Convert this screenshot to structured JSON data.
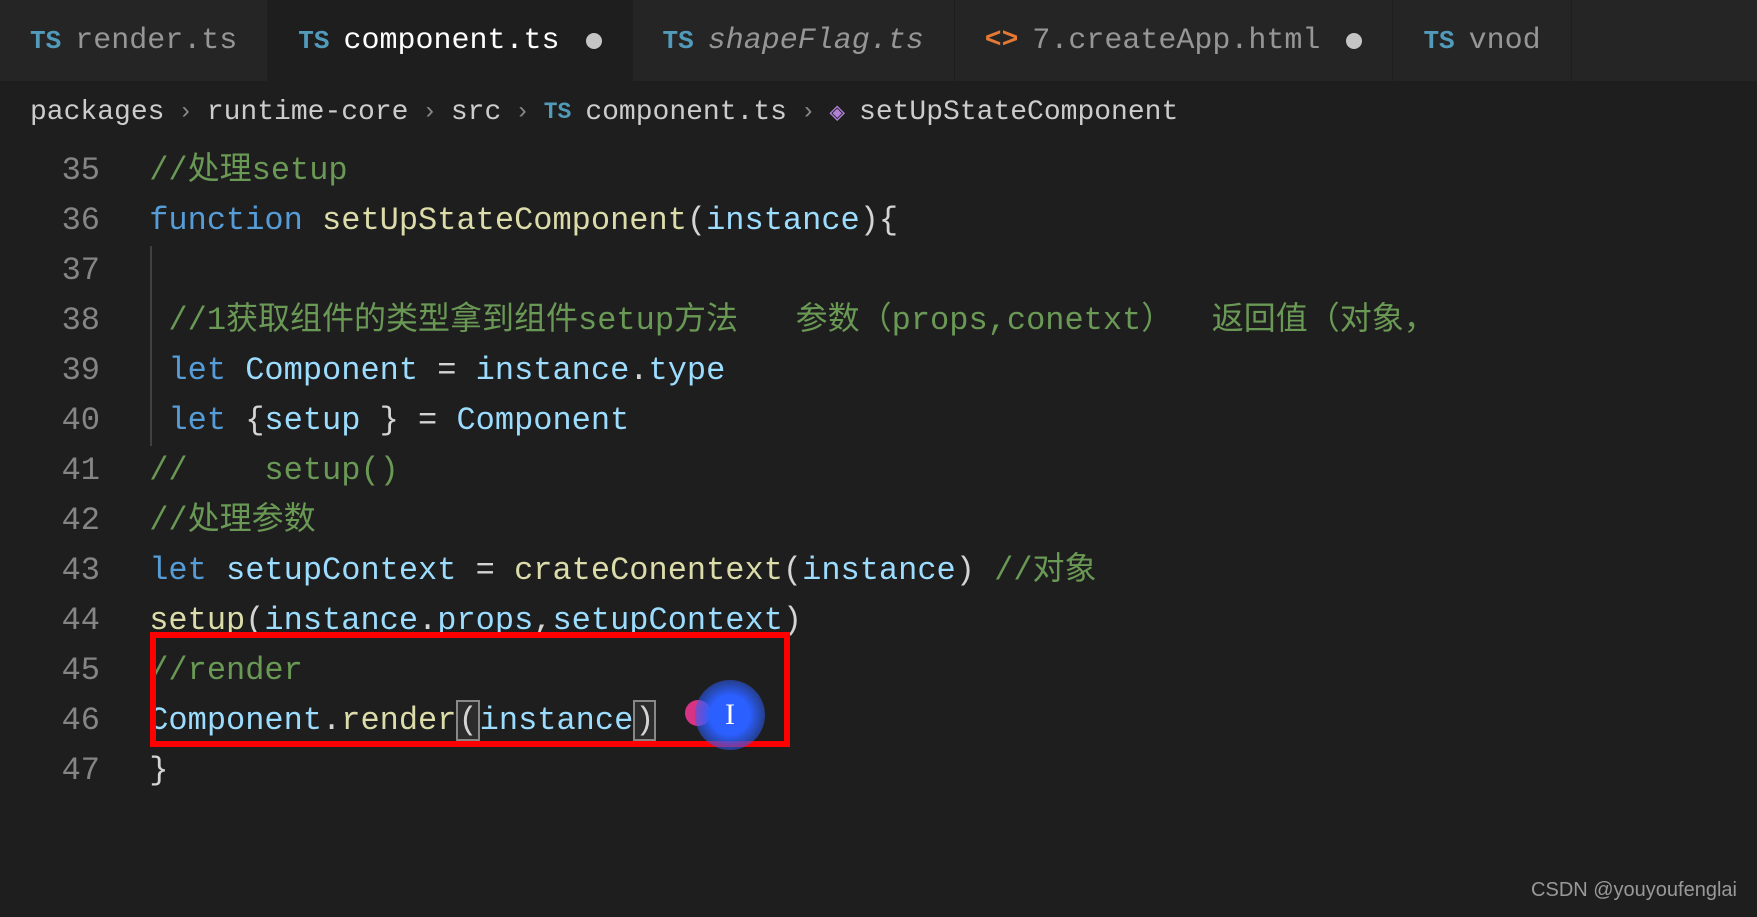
{
  "tabs": [
    {
      "icon": "TS",
      "label": "render.ts",
      "dirty": false,
      "active": false
    },
    {
      "icon": "TS",
      "label": "component.ts",
      "dirty": true,
      "active": true
    },
    {
      "icon": "TS",
      "label": "shapeFlag.ts",
      "dirty": false,
      "active": false
    },
    {
      "icon": "<>",
      "label": "7.createApp.html",
      "dirty": true,
      "active": false
    },
    {
      "icon": "TS",
      "label": "vnod",
      "dirty": false,
      "active": false
    }
  ],
  "breadcrumbs": {
    "parts": [
      "packages",
      "runtime-core",
      "src"
    ],
    "file_icon": "TS",
    "file": "component.ts",
    "symbol_icon": "◈",
    "symbol": "setUpStateComponent"
  },
  "lines": {
    "l35": {
      "num": "35",
      "comment": "//处理setup"
    },
    "l36": {
      "num": "36",
      "kw": "function",
      "fn": "setUpStateComponent",
      "param": "instance"
    },
    "l37": {
      "num": "37"
    },
    "l38": {
      "num": "38",
      "comment": "//1获取组件的类型拿到组件setup方法   参数（props,conetxt）  返回值（对象，"
    },
    "l39": {
      "num": "39",
      "kw": "let",
      "var1": "Component",
      "var2": "instance",
      "prop": "type"
    },
    "l40": {
      "num": "40",
      "kw": "let",
      "var1": "setup",
      "var2": "Component"
    },
    "l41": {
      "num": "41",
      "comment": "//    setup()"
    },
    "l42": {
      "num": "42",
      "comment": "//处理参数"
    },
    "l43": {
      "num": "43",
      "kw": "let",
      "var1": "setupContext",
      "fn": "crateConentext",
      "arg": "instance",
      "comment": "//对象"
    },
    "l44": {
      "num": "44",
      "fn": "setup",
      "a1": "instance",
      "p1": "props",
      "a2": "setupContext"
    },
    "l45": {
      "num": "45",
      "comment": "//render"
    },
    "l46": {
      "num": "46",
      "obj": "Component",
      "fn": "render",
      "arg": "instance"
    },
    "l47": {
      "num": "47"
    }
  },
  "watermark": "CSDN @youyoufenglai"
}
